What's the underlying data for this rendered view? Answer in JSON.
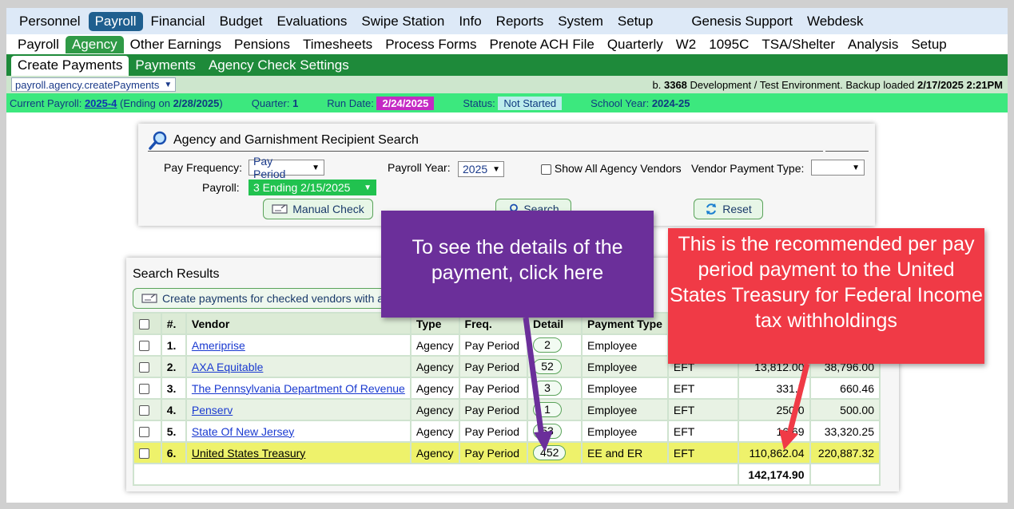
{
  "nav_main": [
    "Personnel",
    "Payroll",
    "Financial",
    "Budget",
    "Evaluations",
    "Swipe Station",
    "Info",
    "Reports",
    "System",
    "Setup",
    "Genesis Support",
    "Webdesk"
  ],
  "nav_sub": [
    "Payroll",
    "Agency",
    "Other Earnings",
    "Pensions",
    "Timesheets",
    "Process Forms",
    "Prenote ACH File",
    "Quarterly",
    "W2",
    "1095C",
    "TSA/Shelter",
    "Analysis",
    "Setup"
  ],
  "nav_tabs": [
    "Create Payments",
    "Payments",
    "Agency Check Settings"
  ],
  "route": "payroll.agency.createPayments",
  "build": {
    "prefix": "b.",
    "number": "3368",
    "text": "Development / Test Environment. Backup loaded",
    "date": "2/17/2025 2:21PM"
  },
  "status_bar": {
    "current_payroll_label": "Current Payroll:",
    "current_payroll": "2025-4",
    "ending_prefix": "(Ending on",
    "ending_date": "2/28/2025",
    "ending_suffix": ")",
    "quarter_label": "Quarter:",
    "quarter": "1",
    "run_date_label": "Run Date:",
    "run_date": "2/24/2025",
    "status_label": "Status:",
    "status": "Not Started",
    "school_year_label": "School Year:",
    "school_year": "2024-25"
  },
  "search": {
    "title": "Agency and Garnishment Recipient Search",
    "pay_frequency_label": "Pay Frequency:",
    "pay_frequency": "Pay Period",
    "payroll_year_label": "Payroll Year:",
    "payroll_year": "2025",
    "show_all_label": "Show All Agency Vendors",
    "vendor_payment_type_label": "Vendor Payment Type:",
    "vendor_payment_type": "",
    "payroll_label": "Payroll:",
    "payroll": "3 Ending 2/15/2025",
    "manual_check": "Manual Check",
    "search_btn": "Search",
    "reset_btn": "Reset"
  },
  "results": {
    "title": "Search Results",
    "create_btn": "Create payments for checked vendors with a",
    "headers": [
      "#.",
      "Vendor",
      "Type",
      "Freq.",
      "Detail",
      "Payment Type"
    ],
    "rows": [
      {
        "n": "1.",
        "vendor": "Ameriprise",
        "type": "Agency",
        "freq": "Pay Period",
        "detail": "2",
        "ptype": "Employee",
        "method": "",
        "amount": "",
        "total": ""
      },
      {
        "n": "2.",
        "vendor": "AXA Equitable",
        "type": "Agency",
        "freq": "Pay Period",
        "detail": "52",
        "ptype": "Employee",
        "method": "EFT",
        "amount": "13,812.00",
        "total": "38,796.00"
      },
      {
        "n": "3.",
        "vendor": "The Pennsylvania Department Of Revenue",
        "type": "Agency",
        "freq": "Pay Period",
        "detail": "3",
        "ptype": "Employee",
        "method": "EFT",
        "amount": "331.7",
        "total": "660.46"
      },
      {
        "n": "4.",
        "vendor": "Penserv",
        "type": "Agency",
        "freq": "Pay Period",
        "detail": "1",
        "ptype": "Employee",
        "method": "EFT",
        "amount": "250.0",
        "total": "500.00"
      },
      {
        "n": "5.",
        "vendor": "State Of New Jersey",
        "type": "Agency",
        "freq": "Pay Period",
        "detail": "53",
        "ptype": "Employee",
        "method": "EFT",
        "amount": "16,69",
        "total": "33,320.25"
      },
      {
        "n": "6.",
        "vendor": "United States Treasury",
        "type": "Agency",
        "freq": "Pay Period",
        "detail": "452",
        "ptype": "EE and ER",
        "method": "EFT",
        "amount": "110,862.04",
        "total": "220,887.32"
      }
    ],
    "grand_total": "142,174.90"
  },
  "callouts": {
    "purple": "To see the details of the payment, click here",
    "red": "This is the recommended per pay period payment to the United States Treasury for Federal Income tax withholdings"
  },
  "colors": {
    "nav_active": "#1f5f8f",
    "tab_bar": "#1e8a3a",
    "status_bar": "#3ce87e",
    "run_date_box": "#c42ac4",
    "highlight_row": "#eef26b",
    "callout_purple": "#6b2f9a",
    "callout_red": "#f03a46"
  }
}
